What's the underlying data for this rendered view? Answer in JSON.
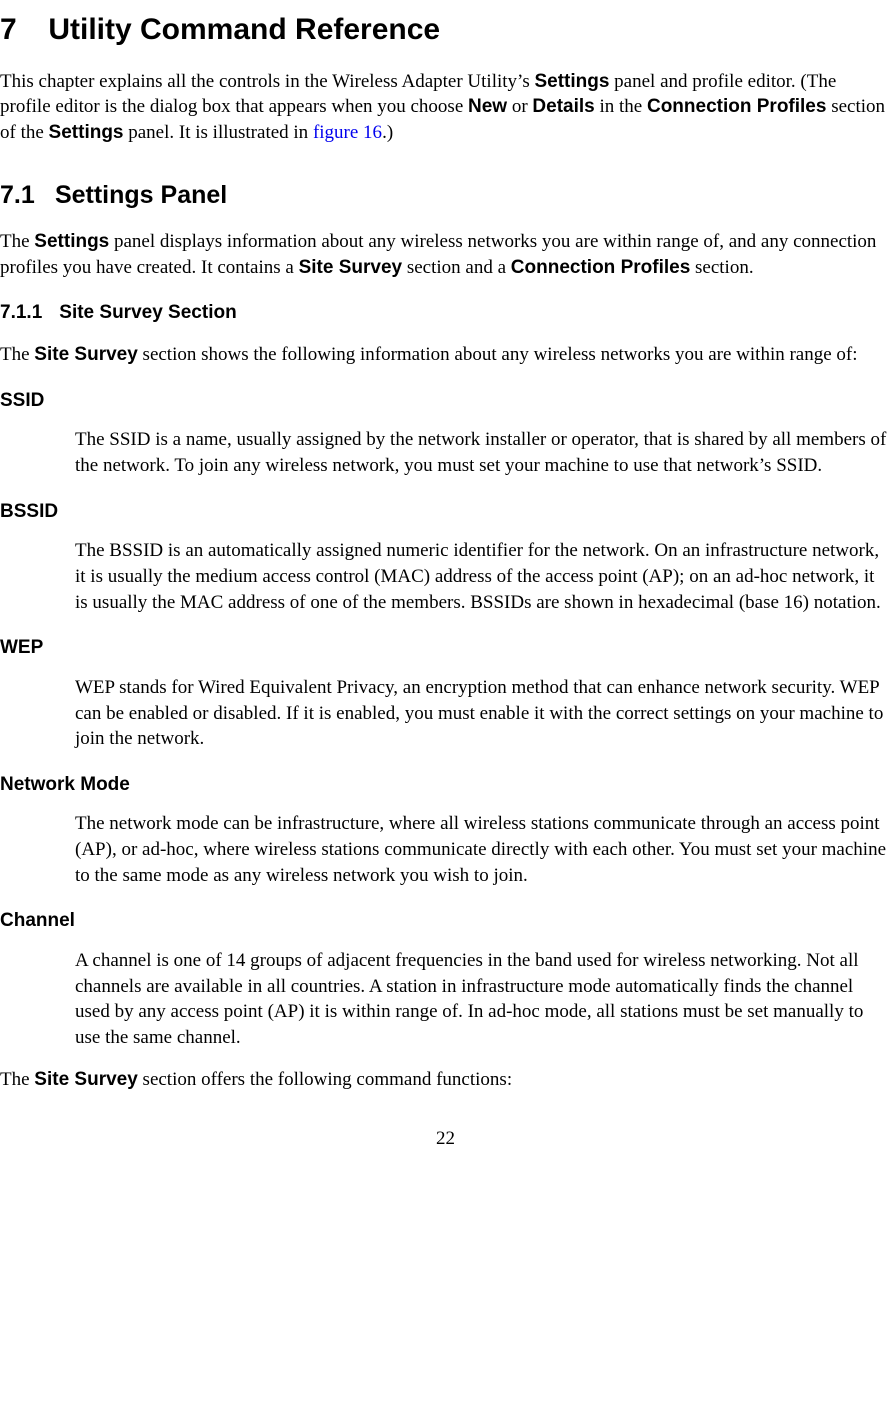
{
  "h1_num": "7",
  "h1_title": "Utility Command Reference",
  "intro": {
    "t1": "This chapter explains all the controls in the Wireless Adapter Utility’s ",
    "b1": "Settings",
    "t2": " panel and profile editor. (The profile editor is the dialog box that appears when you choose ",
    "b2": "New",
    "t3": " or ",
    "b3": "Details",
    "t4": " in the ",
    "b4": "Connection Profiles",
    "t5": " section of the ",
    "b5": "Settings",
    "t6": " panel. It is illustrated in ",
    "link": "figure 16",
    "t7": ".)"
  },
  "h2_num": "7.1",
  "h2_title": "Settings Panel",
  "p71": {
    "t1": "The ",
    "b1": "Settings",
    "t2": " panel displays information about any wireless networks you are within range of, and any connection profiles you have created. It contains a ",
    "b2": "Site Survey",
    "t3": " section and a ",
    "b3": "Connection Profiles",
    "t4": " section."
  },
  "h3_num": "7.1.1",
  "h3_title": "Site Survey Section",
  "p711": {
    "t1": "The ",
    "b1": "Site Survey",
    "t2": " section shows the following information about any wireless networks you are within range of:"
  },
  "defs": {
    "ssid_term": "SSID",
    "ssid_body": "The SSID is a name, usually assigned by the network installer or operator, that is shared by all members of the network. To join any wireless network, you must set your machine to use that network’s SSID.",
    "bssid_term": "BSSID",
    "bssid_body": "The BSSID is an automatically assigned numeric identifier for the network. On an infrastructure network, it is usually the medium access control (MAC) address of the access point (AP); on an ad-hoc network, it is usually the MAC address of one of the members. BSSIDs are shown in hexadecimal (base 16) notation.",
    "wep_term": "WEP",
    "wep_body": "WEP stands for Wired Equivalent Privacy, an encryption method that can enhance network security. WEP can be enabled or disabled. If it is enabled, you must enable it with the correct settings on your machine to join the network.",
    "mode_term": "Network Mode",
    "mode_body": "The network mode can be infrastructure, where all wireless stations communicate through an access point (AP), or ad-hoc, where wireless stations communicate directly with each other. You must set your machine to the same mode as any wireless network you wish to join.",
    "channel_term": "Channel",
    "channel_body": "A channel is one of 14 groups of adjacent frequencies in the band used for wireless networking. Not all channels are available in all countries. A station in infrastructure mode automatically finds the channel used by any access point (AP) it is within range of. In ad-hoc mode, all stations must be set manually to use the same channel."
  },
  "closing": {
    "t1": "The ",
    "b1": "Site Survey",
    "t2": " section offers the following command functions:"
  },
  "page_number": "22"
}
